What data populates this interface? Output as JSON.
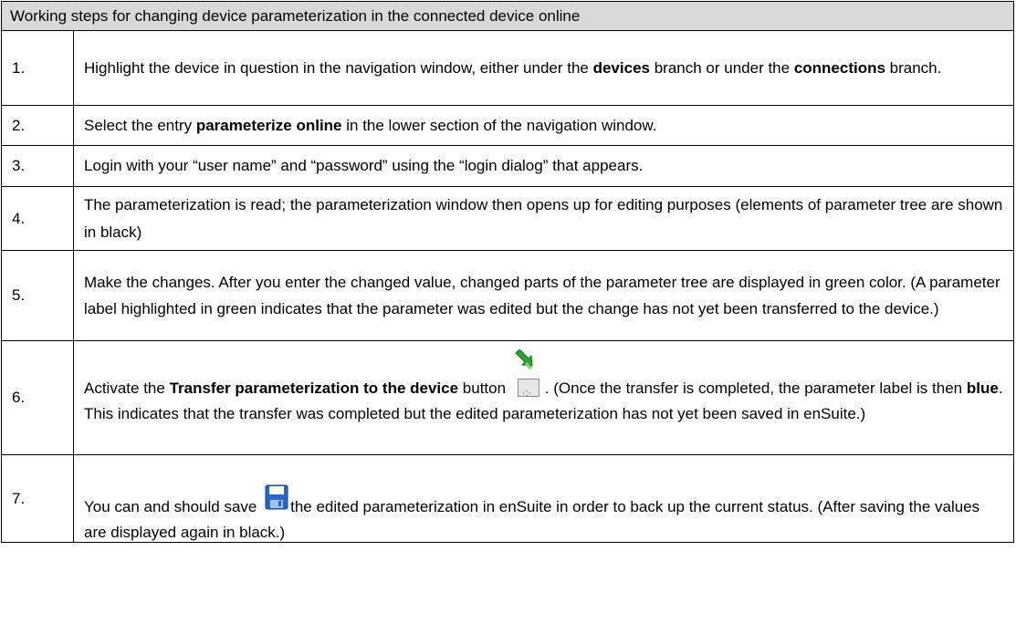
{
  "header": "Working steps for changing device parameterization in the connected device online",
  "rows": [
    {
      "num": "1.",
      "parts": [
        {
          "t": "Highlight the device in question in the navigation window, either under the "
        },
        {
          "t": "devices",
          "b": true
        },
        {
          "t": " branch or under the "
        },
        {
          "t": "connections",
          "b": true
        },
        {
          "t": " branch."
        }
      ]
    },
    {
      "num": "2.",
      "parts": [
        {
          "t": "Select the entry "
        },
        {
          "t": "parameterize online",
          "b": true
        },
        {
          "t": " in the lower section of the navigation window."
        }
      ]
    },
    {
      "num": "3.",
      "parts": [
        {
          "t": "Login with your “user name” and “password” using the “login dialog” that appears."
        }
      ]
    },
    {
      "num": "4.",
      "parts": [
        {
          "t": "The parameterization is read; the parameterization window then opens up for editing purposes (elements of parameter tree are shown in black)"
        }
      ]
    },
    {
      "num": "5.",
      "parts": [
        {
          "t": "Make the changes. After you enter the changed value, changed parts of the parameter tree are displayed in green color. (A parameter label highlighted in green indicates that the parameter was edited but the change has not yet been transferred to the device.)"
        }
      ]
    },
    {
      "num": "6.",
      "parts": [
        {
          "t": "Activate the "
        },
        {
          "t": "Transfer parameterization to the device",
          "b": true
        },
        {
          "t": " button "
        },
        {
          "icon": "transfer-to-device-icon"
        },
        {
          "t": ". (Once the transfer is completed, the parameter label is then "
        },
        {
          "t": "blue",
          "b": true
        },
        {
          "t": ". This indicates that the transfer was completed but the edited parameterization has not yet been saved in enSuite.)"
        }
      ]
    },
    {
      "num": "7.",
      "parts": [
        {
          "t": "You can and should save "
        },
        {
          "icon": "save-icon"
        },
        {
          "t": "the edited parameterization in enSuite in order to back up the current status. (After saving the values are displayed again in black.)"
        }
      ]
    }
  ]
}
